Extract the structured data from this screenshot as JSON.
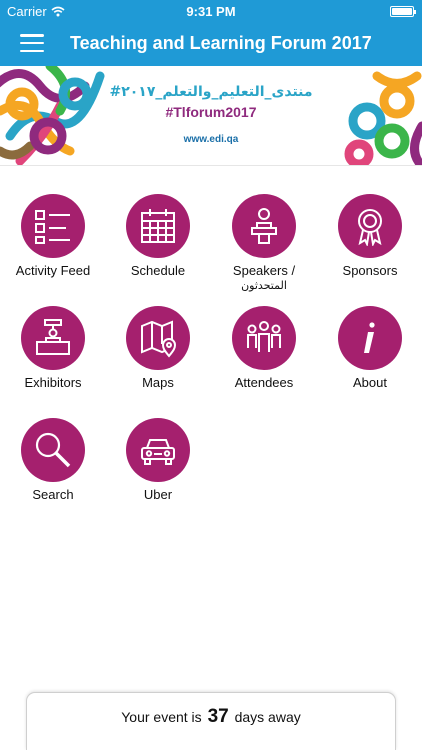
{
  "status_bar": {
    "carrier": "Carrier",
    "time": "9:31 PM"
  },
  "nav": {
    "title": "Teaching and Learning Forum 2017",
    "menu_icon": "hamburger-menu-icon"
  },
  "banner": {
    "arabic_title": "#منتدى_التعليم_والتعلم_٢٠١٧",
    "hashtag": "#Tlforum2017",
    "website": "www.edi.qa"
  },
  "accent_color": "#a5206e",
  "header_color": "#1f9ad6",
  "menu": [
    {
      "label": "Activity Feed",
      "icon": "list-icon"
    },
    {
      "label": "Schedule",
      "icon": "calendar-icon"
    },
    {
      "label": "Speakers /",
      "sub": "المتحدثون",
      "icon": "podium-icon"
    },
    {
      "label": "Sponsors",
      "icon": "award-ribbon-icon"
    },
    {
      "label": "Exhibitors",
      "icon": "exhibitor-booth-icon"
    },
    {
      "label": "Maps",
      "icon": "map-icon"
    },
    {
      "label": "Attendees",
      "icon": "people-icon"
    },
    {
      "label": "About",
      "icon": "info-icon"
    },
    {
      "label": "Search",
      "icon": "search-icon"
    },
    {
      "label": "Uber",
      "icon": "car-icon"
    }
  ],
  "countdown": {
    "prefix": "Your event is",
    "days": "37",
    "suffix": "days away"
  }
}
